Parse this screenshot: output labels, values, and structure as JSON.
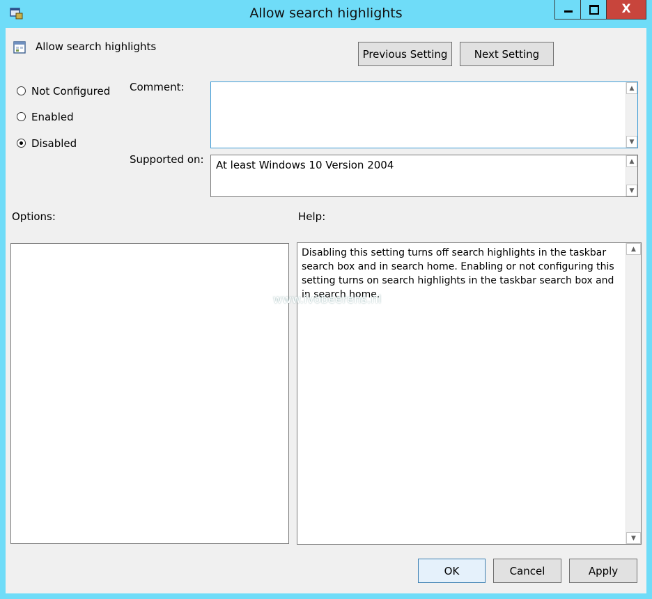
{
  "window": {
    "title": "Allow search highlights",
    "controls": {
      "minimize": "—",
      "maximize": "□",
      "close": "X"
    }
  },
  "header": {
    "policy_name": "Allow search highlights",
    "previous_label": "Previous Setting",
    "next_label": "Next Setting"
  },
  "state": {
    "options": [
      {
        "label": "Not Configured",
        "selected": false
      },
      {
        "label": "Enabled",
        "selected": false
      },
      {
        "label": "Disabled",
        "selected": true
      }
    ]
  },
  "comment": {
    "label": "Comment:",
    "value": ""
  },
  "supported": {
    "label": "Supported on:",
    "value": "At least Windows 10 Version 2004"
  },
  "options_panel": {
    "label": "Options:"
  },
  "help_panel": {
    "label": "Help:",
    "text": "Disabling this setting turns off search highlights in the taskbar search box and in search home. Enabling or not configuring this setting turns on search highlights in the taskbar search box and in search home."
  },
  "footer": {
    "ok_label": "OK",
    "cancel_label": "Cancel",
    "apply_label": "Apply"
  },
  "watermark": "www.ivobeerens.nl",
  "colors": {
    "titlebar": "#6fdcf8",
    "close": "#c8453c",
    "client": "#f0f0f0"
  }
}
